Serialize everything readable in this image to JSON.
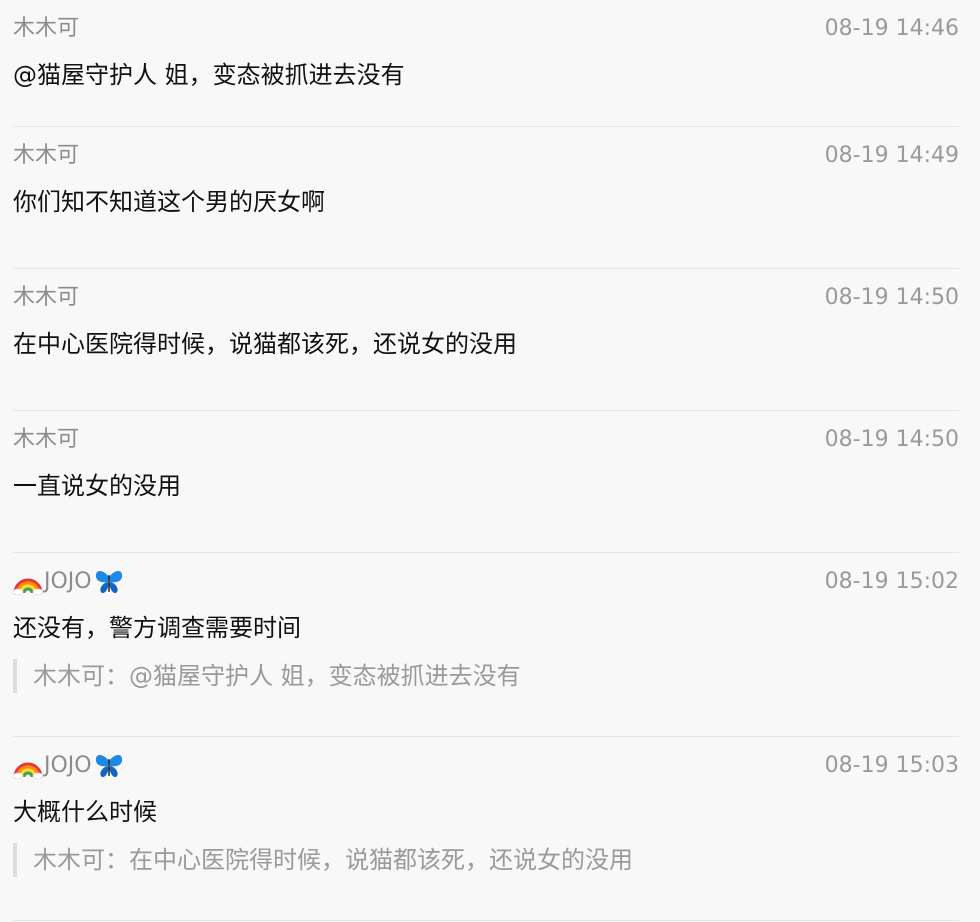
{
  "messages": [
    {
      "author": "木木可",
      "time": "08-19 14:46",
      "text": "@猫屋守护人 姐，变态被抓进去没有"
    },
    {
      "author": "木木可",
      "time": "08-19 14:49",
      "text": "你们知不知道这个男的厌女啊"
    },
    {
      "author": "木木可",
      "time": "08-19 14:50",
      "text": "在中心医院得时候，说猫都该死，还说女的没用"
    },
    {
      "author": "木木可",
      "time": "08-19 14:50",
      "text": "一直说女的没用"
    },
    {
      "author": "JOJO",
      "author_prefix_icon": "rainbow-icon",
      "author_suffix_icon": "butterfly-icon",
      "time": "08-19 15:02",
      "text": "还没有，警方调查需要时间",
      "quote": "木木可：@猫屋守护人 姐，变态被抓进去没有"
    },
    {
      "author": "JOJO",
      "author_prefix_icon": "rainbow-icon",
      "author_suffix_icon": "butterfly-icon",
      "time": "08-19 15:03",
      "text": "大概什么时候",
      "quote": "木木可：在中心医院得时候，说猫都该死，还说女的没用"
    }
  ],
  "colors": {
    "background": "#f8f8f8",
    "text": "#111111",
    "muted": "#8c8c8c",
    "timestamp": "#9a9a9a",
    "divider": "#e6e6e6",
    "quote_bar": "#dddddd"
  }
}
